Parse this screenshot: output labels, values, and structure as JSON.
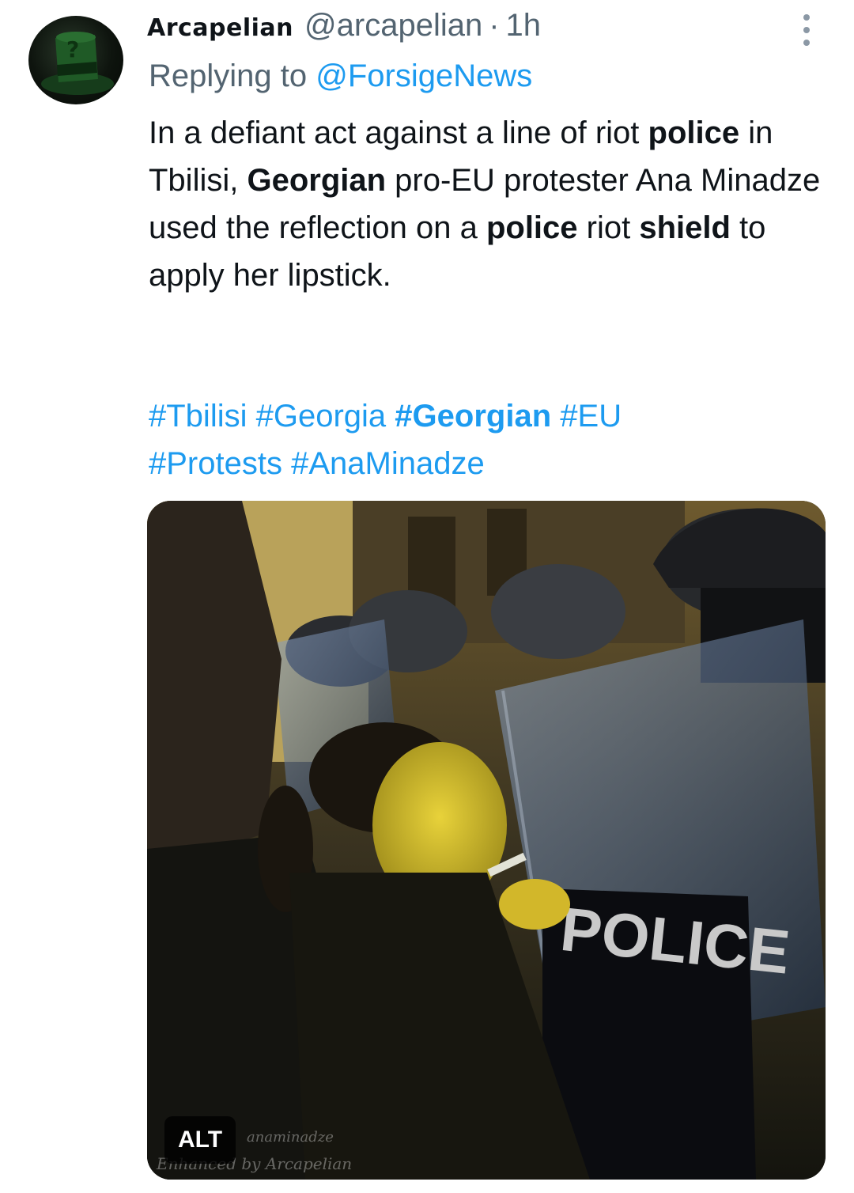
{
  "author": {
    "display_name": "Arcapelian",
    "handle": "@arcapelian",
    "separator": "·",
    "time": "1h"
  },
  "reply": {
    "prefix": "Replying to",
    "mention": "@ForsigeNews"
  },
  "text": {
    "s1": "In a defiant act against a line of riot ",
    "s2": "police",
    "s3": " in Tbilisi, ",
    "s4": "Georgian",
    "s5": " pro-EU protester Ana Minadze used the reflection on a ",
    "s6": "police",
    "s7": " riot ",
    "s8": "shield",
    "s9": " to apply her lipstick."
  },
  "hashtags": {
    "h1": "#Tbilisi",
    "h2": "#Georgia",
    "h3": "#Georgian",
    "h4": "#EU",
    "h5": "#Protests",
    "h6": "#AnaMinadze"
  },
  "media": {
    "alt_label": "ALT",
    "shield_text": "POLICE",
    "watermark_1": "anaminadze",
    "watermark_2": "Enhanced by Arcapelian"
  },
  "colors": {
    "link": "#1d9bf0",
    "secondary_text": "#536471",
    "primary_text": "#0f1419"
  },
  "icons": {
    "more": "more-vertical-icon",
    "avatar": "green-top-hat-avatar"
  }
}
